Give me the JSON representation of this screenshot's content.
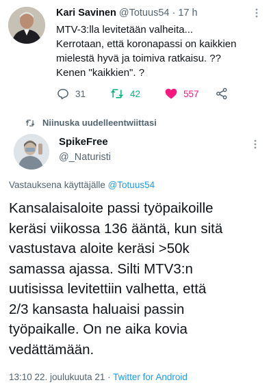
{
  "quoted_tweet": {
    "author_name": "Kari Savinen",
    "author_handle": "@Totuus54",
    "separator": " · ",
    "time": "17 h",
    "lines": [
      "MTV-3:lla levitetään valheita...",
      "Kerrotaan, että koronapassi on kaikkien",
      "mielestä hyvä ja toimiva ratkaisu. ??",
      "Kenen \"kaikkien\". ?"
    ],
    "reply_count": "31",
    "retweet_count": "42",
    "like_count": "557"
  },
  "retweet_notice": "Niinuska uudelleentwiittasi",
  "reply_tweet": {
    "author_name": "SpikeFree",
    "author_handle": "@_Naturisti",
    "reply_prefix": "Vastauksena käyttäjälle ",
    "reply_mention": "@Totuus54",
    "lines": [
      "Kansalaisaloite passi työpaikoille",
      "keräsi viikossa 136 ääntä, kun sitä",
      "vastustava aloite keräsi >50k",
      "samassa ajassa. Silti MTV3:n",
      "uutisissa levitettiin valhetta, että",
      "2/3 kansasta haluaisi passin",
      "työpaikalle. On ne aika kovia",
      "vedättämään."
    ],
    "timestamp": "13:10 22. joulukuuta 21",
    "separator": " · ",
    "source": "Twitter for Android"
  },
  "colors": {
    "accent": "#1d9bf0",
    "secondary_text": "#536471",
    "retweet": "#00ba7c",
    "like": "#f91880"
  }
}
